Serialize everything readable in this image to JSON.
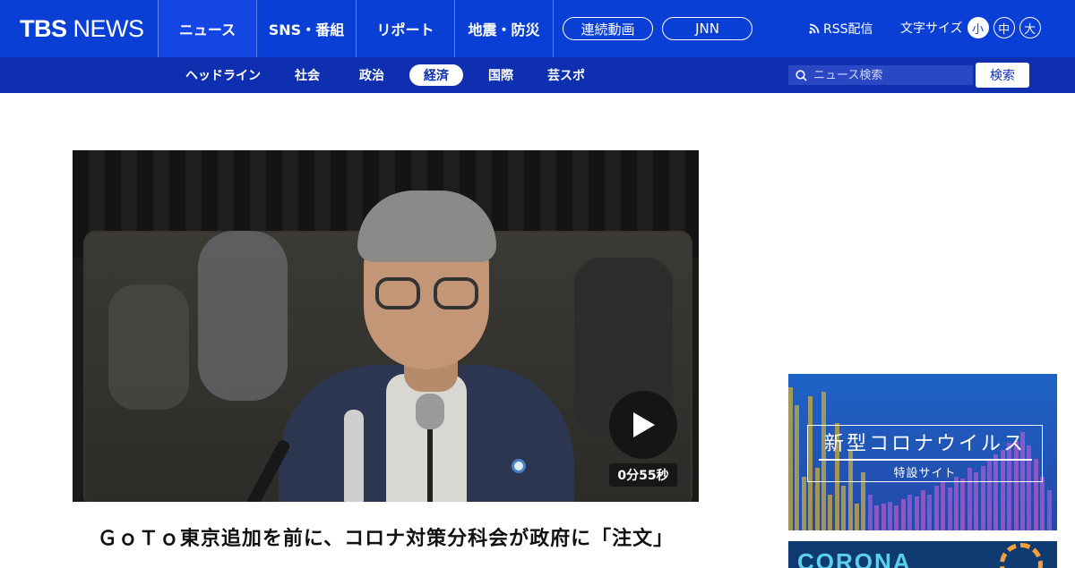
{
  "header": {
    "logo_tbs": "TBS",
    "logo_news": "NEWS",
    "nav": [
      {
        "label": "ニュース",
        "active": true
      },
      {
        "label": "SNS・番組",
        "active": false
      },
      {
        "label": "リポート",
        "active": false
      },
      {
        "label": "地震・防災",
        "active": false
      }
    ],
    "pills": [
      "連続動画",
      "JNN"
    ],
    "rss_label": "RSS配信",
    "fontsize": {
      "label": "文字サイズ",
      "options": [
        "小",
        "中",
        "大"
      ],
      "selected": "小"
    }
  },
  "subnav": {
    "items": [
      {
        "label": "ヘッドライン",
        "active": false
      },
      {
        "label": "社会",
        "active": false
      },
      {
        "label": "政治",
        "active": false
      },
      {
        "label": "経済",
        "active": true
      },
      {
        "label": "国際",
        "active": false
      },
      {
        "label": "芸スポ",
        "active": false
      }
    ],
    "search_placeholder": "ニュース検索",
    "search_button": "検索"
  },
  "article": {
    "duration": "0分55秒",
    "headline": "ＧｏＴｏ東京追加を前に、コロナ対策分科会が政府に「注文」"
  },
  "sidebar": {
    "banner_title": "新型コロナウイルス",
    "banner_subtitle": "特設サイト",
    "banner2_text": "CORONA"
  },
  "colors": {
    "header_blue": "#0a3fd6",
    "subnav_blue": "#0d2fb0",
    "banner_blue": "#1e63c6"
  },
  "icons": [
    "rss-icon",
    "search-icon",
    "play-icon"
  ]
}
